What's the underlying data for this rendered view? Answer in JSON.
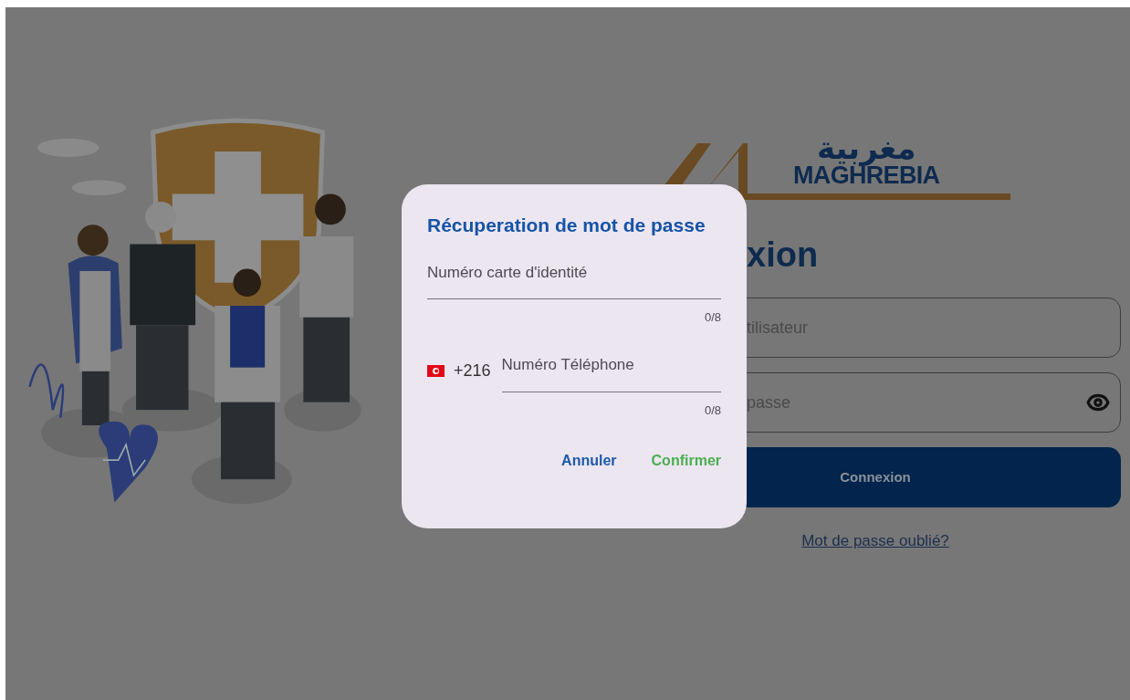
{
  "login": {
    "logo": {
      "arabic": "مغربية",
      "latin": "MAGHREBIA"
    },
    "heading": "xion",
    "fields": [
      {
        "kind": "text",
        "placeholder": "tilisateur"
      },
      {
        "kind": "password",
        "placeholder": "passe"
      }
    ],
    "submit": "Connexion",
    "forgot_link": "Mot de passe oublié?"
  },
  "dialog": {
    "title": "Récuperation de mot de passe",
    "fields": [
      {
        "kind": "text",
        "placeholder": "Numéro carte d'identité",
        "counter": "0/8"
      },
      {
        "kind": "phone",
        "prefix": "+216",
        "placeholder": "Numéro Téléphone",
        "counter": "0/8"
      }
    ],
    "actions": [
      {
        "kind": "cancel",
        "label": "Annuler"
      },
      {
        "kind": "confirm",
        "label": "Confirmer"
      }
    ]
  }
}
